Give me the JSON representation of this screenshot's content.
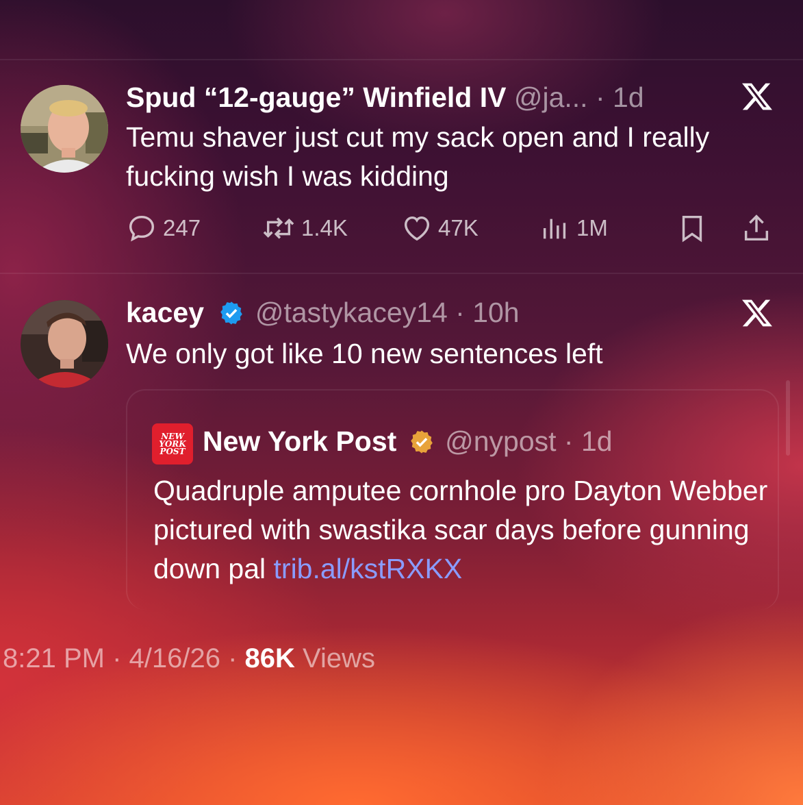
{
  "tweets": [
    {
      "name": "Spud “12-gauge” Winfield IV",
      "handle": "@ja...",
      "time": "1d",
      "text": "Temu shaver just cut my sack open and I really fucking wish I was kidding",
      "stats": {
        "replies": "247",
        "reposts": "1.4K",
        "likes": "47K",
        "views": "1M"
      },
      "avatar_icon": "user-photo"
    },
    {
      "name": "kacey",
      "verified": true,
      "handle": "@tastykacey14",
      "time": "10h",
      "text": "We only got like 10 new sentences left",
      "avatar_icon": "user-photo",
      "quote": {
        "logo_text": "NEW YORK POST",
        "name": "New York Post",
        "verified_color": "#e8a33a",
        "handle": "@nypost",
        "time": "1d",
        "text": "Quadruple amputee cornhole pro Dayton Webber pictured with swastika scar days before gunning down pal",
        "link": "trib.al/kstRXKX"
      }
    }
  ],
  "footer": {
    "time": "8:21 PM",
    "date": "4/16/26",
    "views_count": "86K",
    "views_label": "Views"
  },
  "colors": {
    "verified_blue": "#1d9bf0",
    "link": "#8a9cff",
    "newyorkpost_red": "#e01f2d"
  }
}
